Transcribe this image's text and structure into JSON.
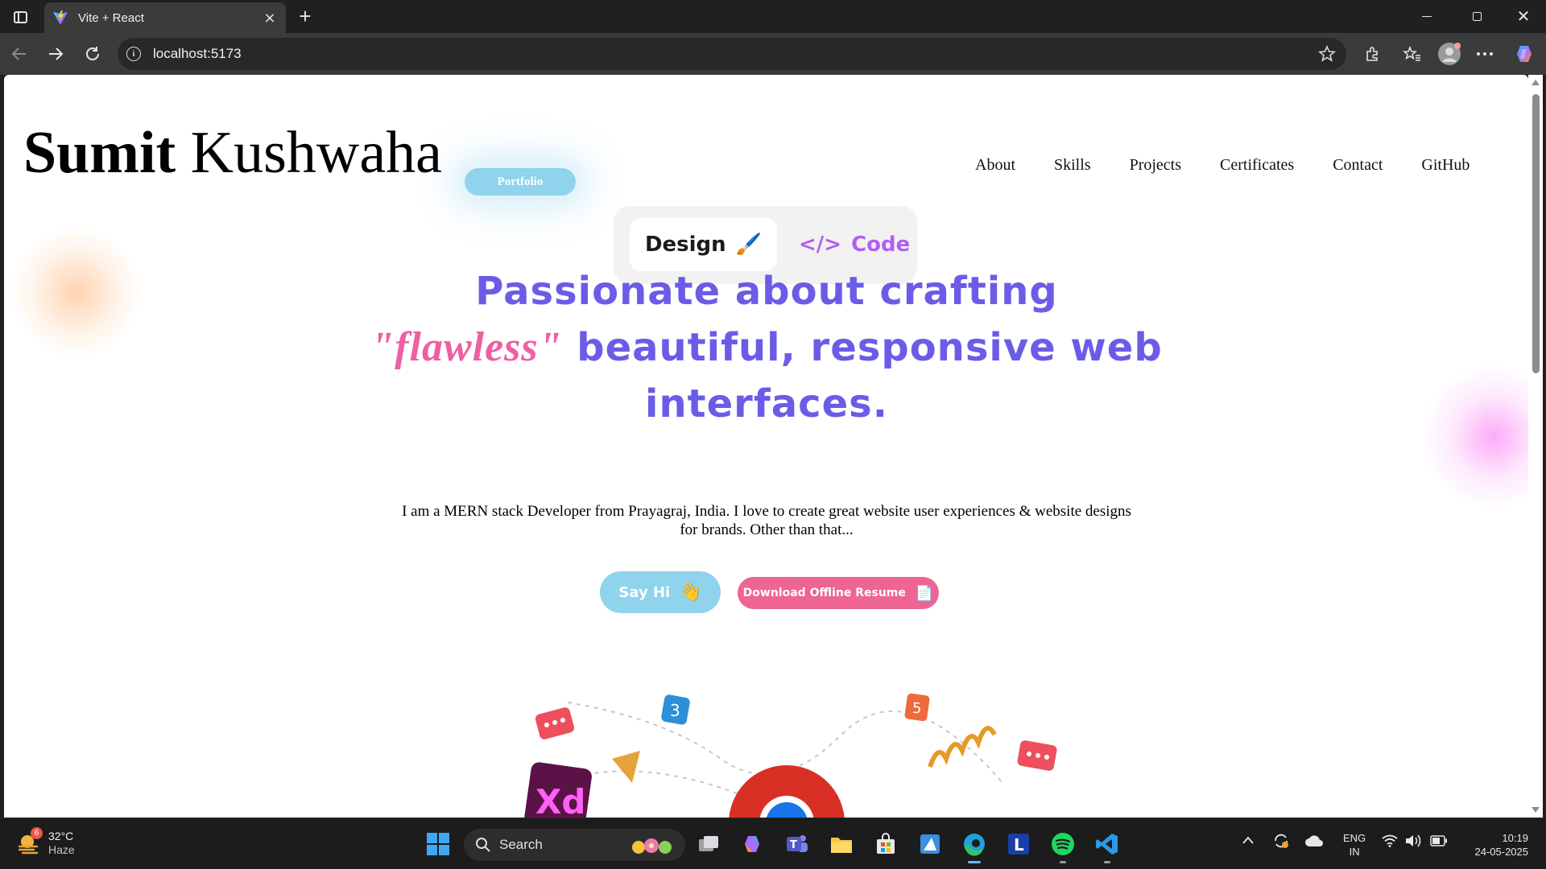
{
  "browser": {
    "tab_title": "Vite + React",
    "new_tab": "+",
    "close_glyph": "×",
    "url": "localhost:5173"
  },
  "page": {
    "logo_first": "Sumit",
    "logo_last": "Kushwaha",
    "badge": "Portfolio",
    "nav": [
      "About",
      "Skills",
      "Projects",
      "Certificates",
      "Contact",
      "GitHub"
    ],
    "toggle": {
      "design_label": "Design",
      "design_icon": "🖌️",
      "code_symbol": "</>",
      "code_label": "Code"
    },
    "headline": {
      "line1": "Passionate about crafting",
      "flawless": "\"flawless\"",
      "line2_rest": "beautiful, responsive web",
      "line3": "interfaces."
    },
    "intro": "I am a MERN stack Developer from Prayagraj, India. I love to create great website user experiences & website designs for brands. Other than that...",
    "say_hi": "Say Hi",
    "say_hi_icon": "👋",
    "resume": "Download Offline Resume",
    "resume_icon": "📄"
  },
  "taskbar": {
    "weather_badge": "6",
    "temperature": "32°C",
    "condition": "Haze",
    "search_label": "Search",
    "lang_top": "ENG",
    "lang_bottom": "IN",
    "time": "10:19",
    "date": "24-05-2025"
  },
  "colors": {
    "accent_purple": "#6b5ce7",
    "accent_pink": "#ee5fa3",
    "sky_blue": "#8fd3ec",
    "resume_pink": "#ef6592"
  }
}
